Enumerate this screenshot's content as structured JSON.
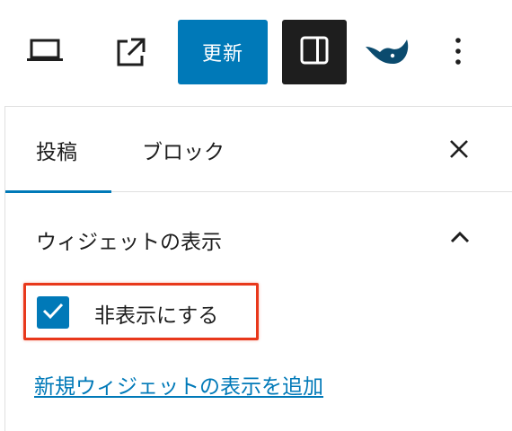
{
  "toolbar": {
    "preview_icon": "laptop-icon",
    "view_icon": "external-link-icon",
    "update_label": "更新",
    "settings_icon": "sidebar-toggle-icon",
    "jetpack_icon": "jetpack-icon",
    "more_icon": "more-vertical-icon"
  },
  "tabs": [
    {
      "label": "投稿",
      "active": true
    },
    {
      "label": "ブロック",
      "active": false
    }
  ],
  "close_icon": "close-icon",
  "section": {
    "title": "ウィジェットの表示",
    "collapse_icon": "chevron-up-icon",
    "checkbox": {
      "label": "非表示にする",
      "checked": true
    },
    "link": "新規ウィジェットの表示を追加"
  },
  "colors": {
    "accent": "#0079b8",
    "dark": "#1e1e1e",
    "highlight": "#e8381b",
    "border": "#e0e0e0"
  }
}
